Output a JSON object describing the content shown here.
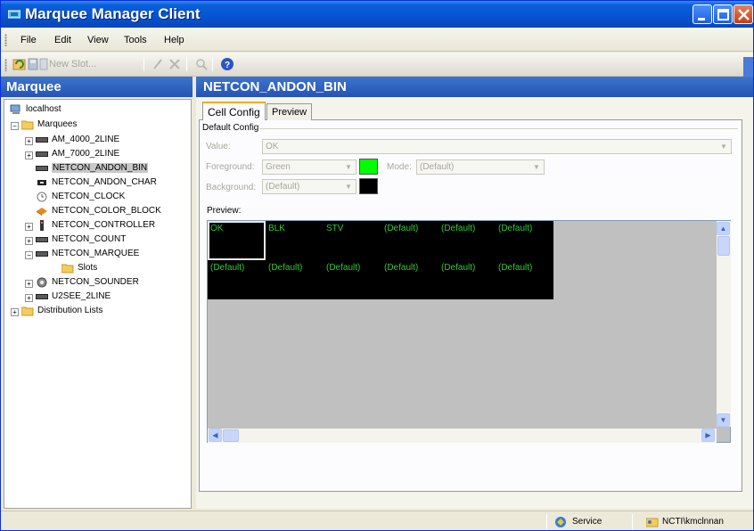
{
  "window": {
    "title": "Marquee Manager Client"
  },
  "menu": {
    "items": [
      "File",
      "Edit",
      "View",
      "Tools",
      "Help"
    ]
  },
  "toolbar": {
    "new_slot_label": "New Slot..."
  },
  "left_panel": {
    "title": "Marquee",
    "tree": [
      {
        "label": "localhost",
        "icon": "computer-icon"
      },
      {
        "label": "Marquees",
        "icon": "folder-icon"
      },
      {
        "label": "AM_4000_2LINE",
        "icon": "marquee-display-icon"
      },
      {
        "label": "AM_7000_2LINE",
        "icon": "marquee-display-icon"
      },
      {
        "label": "NETCON_ANDON_BIN",
        "icon": "marquee-display-icon",
        "selected": true
      },
      {
        "label": "NETCON_ANDON_CHAR",
        "icon": "andon-char-icon"
      },
      {
        "label": "NETCON_CLOCK",
        "icon": "clock-icon"
      },
      {
        "label": "NETCON_COLOR_BLOCK",
        "icon": "color-block-icon"
      },
      {
        "label": "NETCON_CONTROLLER",
        "icon": "controller-icon"
      },
      {
        "label": "NETCON_COUNT",
        "icon": "marquee-display-icon"
      },
      {
        "label": "NETCON_MARQUEE",
        "icon": "marquee-display-icon"
      },
      {
        "label": "Slots",
        "icon": "folder-icon"
      },
      {
        "label": "NETCON_SOUNDER",
        "icon": "sounder-icon"
      },
      {
        "label": "U2SEE_2LINE",
        "icon": "marquee-display-icon"
      },
      {
        "label": "Distribution Lists",
        "icon": "folder-icon"
      }
    ]
  },
  "right_panel": {
    "title": "NETCON_ANDON_BIN",
    "tabs": [
      "Cell Config",
      "Preview"
    ],
    "active_tab": "Cell Config",
    "group_title": "Default Config",
    "value_label": "Value:",
    "value": "OK",
    "foreground_label": "Foreground:",
    "foreground_value": "Green",
    "mode_label": "Mode:",
    "mode_value": "(Default)",
    "background_label": "Background:",
    "background_value": "(Default)",
    "foreground_color": "#00ff00",
    "background_color": "#000000",
    "preview_label": "Preview:",
    "preview_rows": [
      [
        "OK",
        "BLK",
        "STV",
        "(Default)",
        "(Default)",
        "(Default)"
      ],
      [
        "(Default)",
        "(Default)",
        "(Default)",
        "(Default)",
        "(Default)",
        "(Default)"
      ]
    ],
    "cell_text_color": "#2ecc2e"
  },
  "statusbar": {
    "service_label": "Service",
    "user_label": "NCTI\\kmclnnan"
  }
}
